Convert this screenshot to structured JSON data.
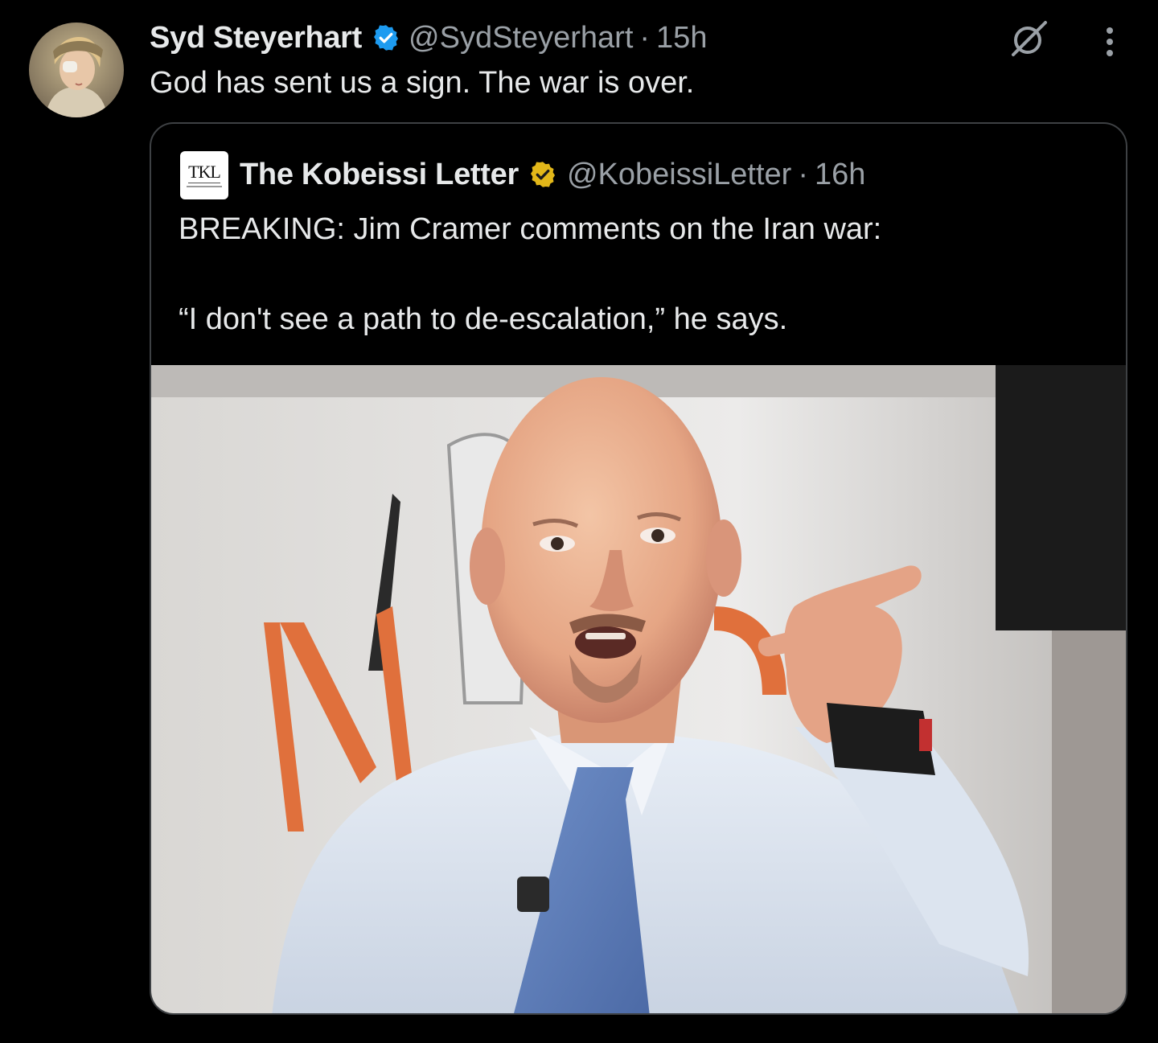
{
  "tweet": {
    "author": {
      "display_name": "Syd Steyerhart",
      "handle": "@SydSteyerhart",
      "verified": true,
      "verified_color": "#1d9bf0"
    },
    "separator": "·",
    "time": "15h",
    "text": "God has sent us a sign. The war is over.",
    "icons": {
      "grok": "grok-icon",
      "more": "more-vertical-icon"
    }
  },
  "quoted_tweet": {
    "author": {
      "display_name": "The Kobeissi Letter",
      "handle": "@KobeissiLetter",
      "verified": true,
      "verified_color": "#e2b719",
      "avatar_logo_text": "TKL"
    },
    "separator": "·",
    "time": "16h",
    "text_line_1": "BREAKING: Jim Cramer comments on the Iran war:",
    "text_line_2": "“I don't see a path to de-escalation,” he says.",
    "media": {
      "kind": "photo",
      "subject": "man pointing at camera in studio"
    }
  },
  "colors": {
    "background": "#000000",
    "primary_text": "#e7e9ea",
    "secondary_text": "#9aa0a6",
    "card_border": "#3e4144"
  }
}
